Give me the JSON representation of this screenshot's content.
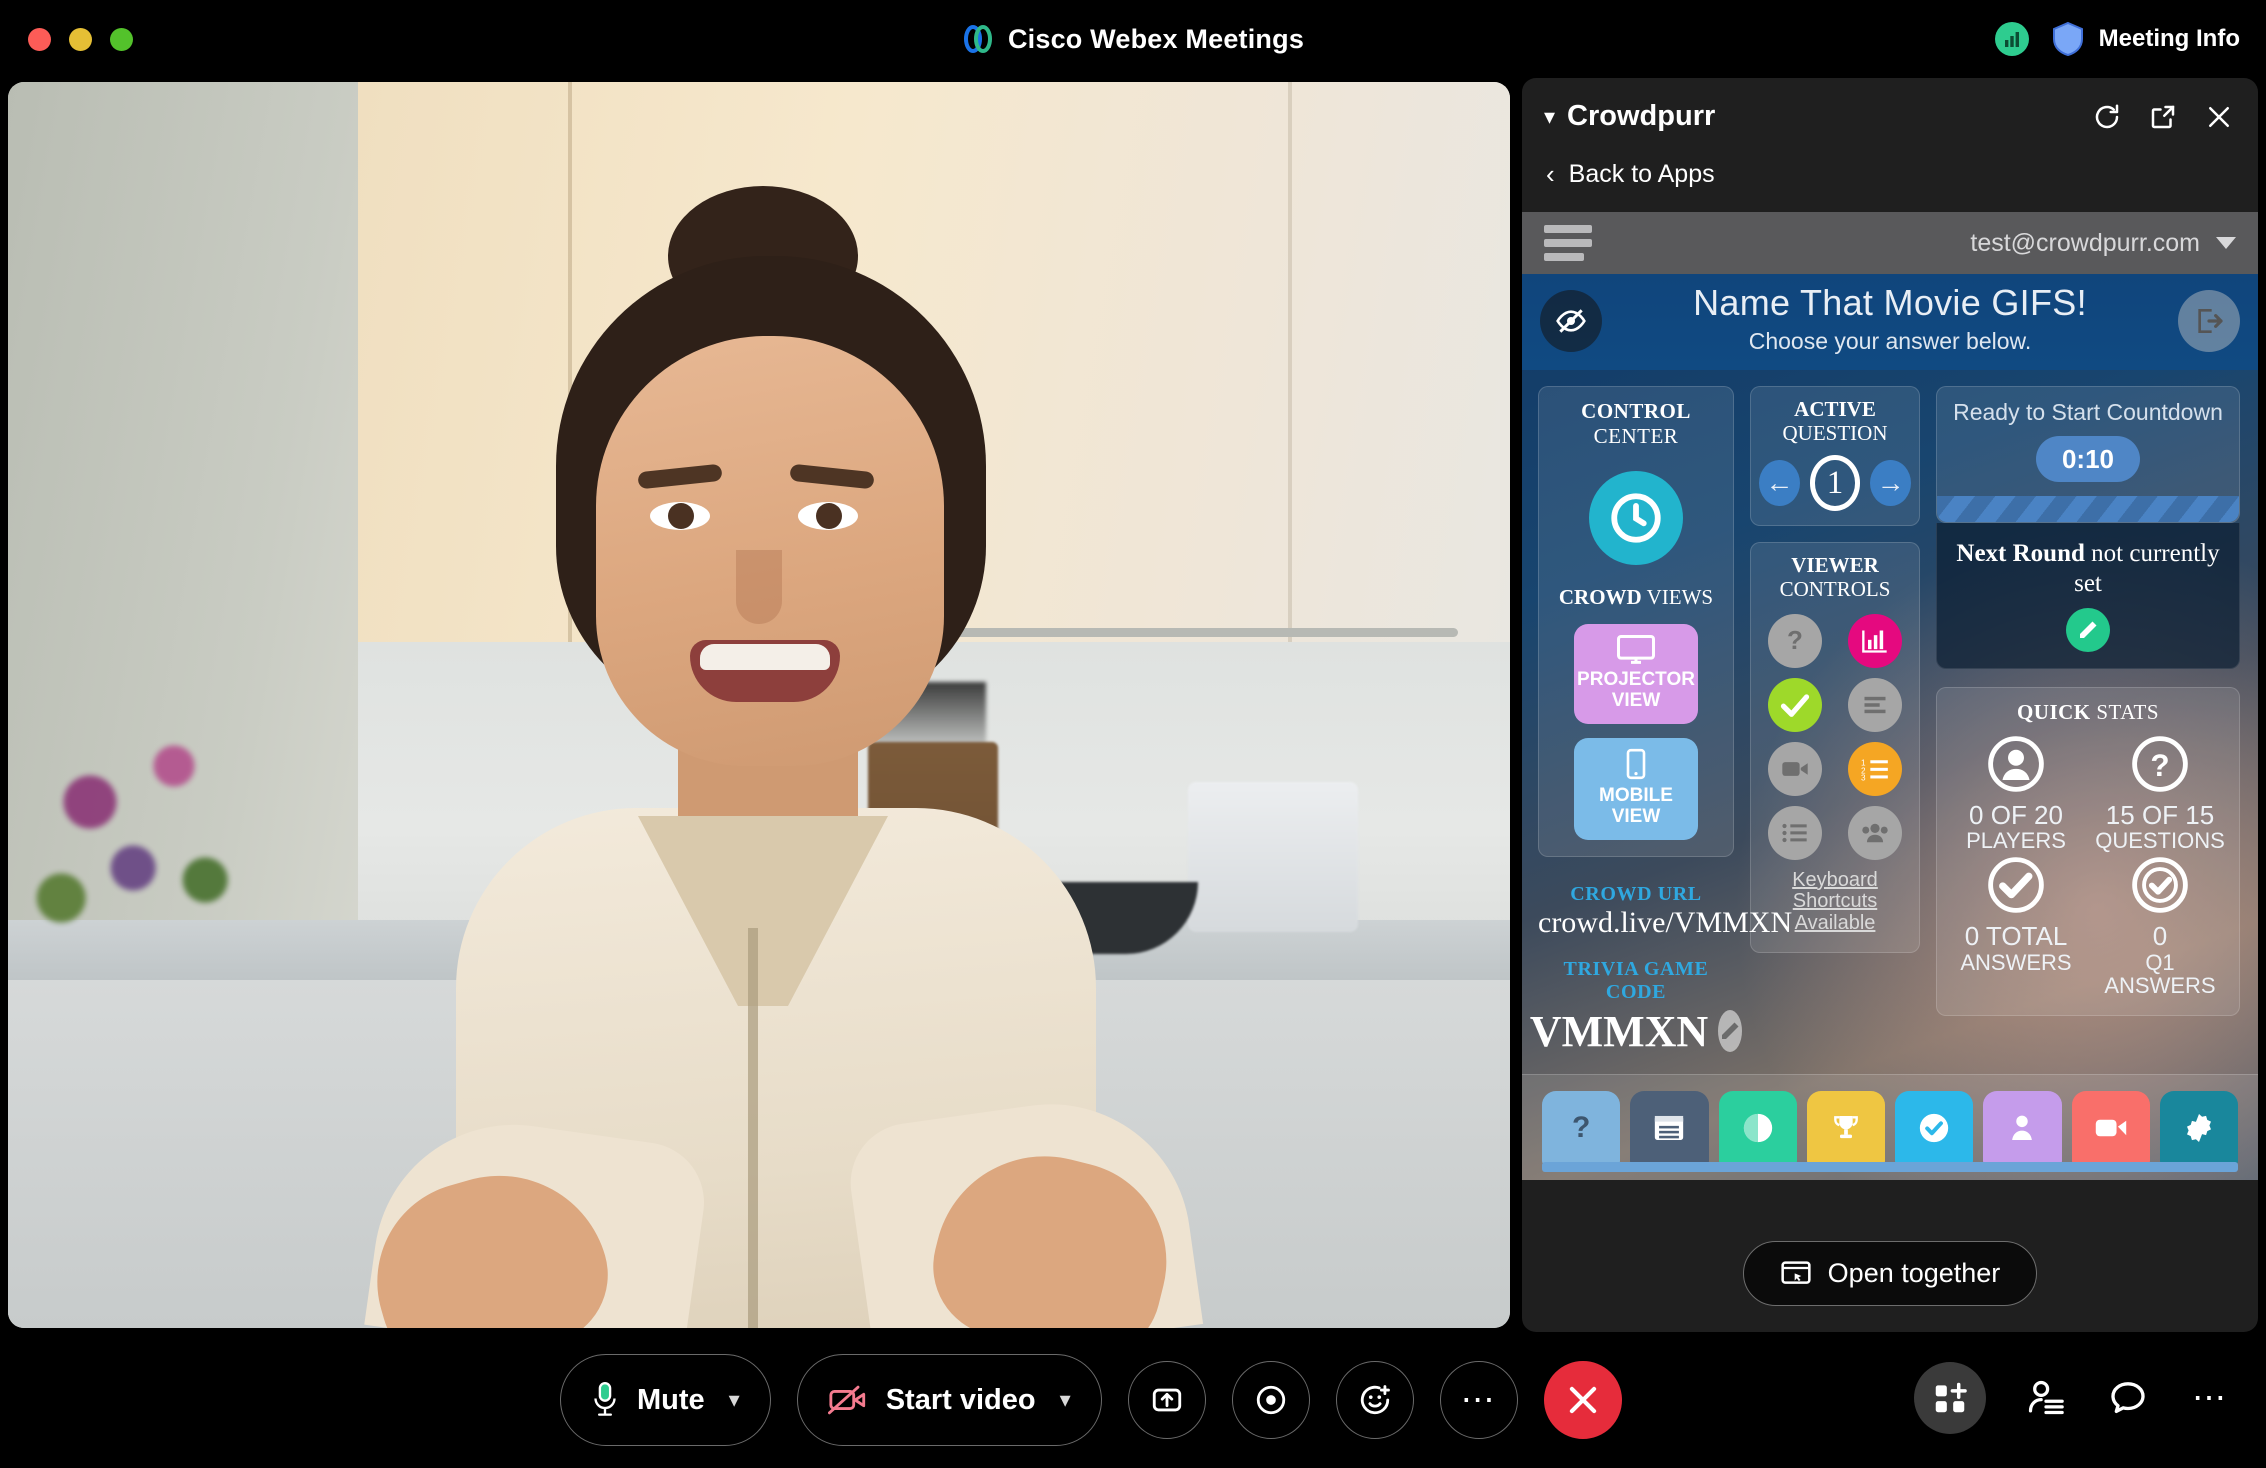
{
  "window": {
    "title": "Cisco Webex Meetings",
    "traffic_lights": [
      "close",
      "minimize",
      "maximize"
    ],
    "network_icon": "signal-bars-icon",
    "shield_icon": "shield-icon",
    "meeting_info_label": "Meeting Info"
  },
  "panel": {
    "title": "Crowdpurr",
    "collapse_icon": "chevron-down-icon",
    "refresh_icon": "refresh-icon",
    "popout_icon": "open-external-icon",
    "close_icon": "close-icon",
    "back_label": "Back to Apps",
    "back_icon": "chevron-left-icon",
    "open_together_label": "Open together",
    "open_together_icon": "screen-share-icon"
  },
  "crowdpurr": {
    "menu_icon": "hamburger-menu-icon",
    "account_email": "test@crowdpurr.com",
    "account_caret": "caret-down-icon",
    "hero": {
      "title": "Name That Movie GIFS!",
      "subtitle": "Choose your answer below.",
      "left_icon": "hide-eye-icon",
      "right_icon": "exit-arrow-icon"
    },
    "control_center": {
      "title_bold": "CONTROL",
      "title_rest": "CENTER",
      "clock_icon": "clock-icon",
      "clock_color": "#22b4cd",
      "crowd_views_bold": "CROWD",
      "crowd_views_rest": "VIEWS",
      "projector_label_line1": "PROJECTOR",
      "projector_label_line2": "VIEW",
      "projector_icon": "monitor-icon",
      "projector_color": "#d79ae8",
      "mobile_label_line1": "MOBILE",
      "mobile_label_line2": "VIEW",
      "mobile_icon": "phone-icon",
      "mobile_color": "#7bbbe8",
      "crowd_url_label": "CROWD URL",
      "crowd_url_value": "crowd.live/VMMXN",
      "game_code_label": "TRIVIA GAME CODE",
      "game_code_value": "VMMXN",
      "edit_icon": "pencil-icon"
    },
    "active_question": {
      "title_bold": "ACTIVE",
      "title_rest": "QUESTION",
      "prev_icon": "arrow-left-icon",
      "next_icon": "arrow-right-icon",
      "number": "1"
    },
    "viewer_controls": {
      "title_bold": "VIEWER",
      "title_rest": "CONTROLS",
      "buttons": [
        {
          "name": "help-icon",
          "glyph": "?",
          "color": "#a6a6a6",
          "active": false
        },
        {
          "name": "bar-chart-icon",
          "glyph": "chart",
          "color": "#e5097f",
          "active": true
        },
        {
          "name": "check-icon",
          "glyph": "check",
          "color": "#9ed92a",
          "active": true
        },
        {
          "name": "align-text-icon",
          "glyph": "lines",
          "color": "#a6a6a6",
          "active": false
        },
        {
          "name": "video-icon",
          "glyph": "video",
          "color": "#a6a6a6",
          "active": false
        },
        {
          "name": "numbered-list-icon",
          "glyph": "numlist",
          "color": "#f5a623",
          "active": true
        },
        {
          "name": "bullet-list-icon",
          "glyph": "bullets",
          "color": "#a6a6a6",
          "active": false
        },
        {
          "name": "group-users-icon",
          "glyph": "group",
          "color": "#a6a6a6",
          "active": false
        }
      ],
      "keyboard_note": "Keyboard Shortcuts Available"
    },
    "countdown": {
      "status": "Ready to Start Countdown",
      "time": "0:10",
      "next_round_bold": "Next Round",
      "next_round_rest": "not currently set",
      "edit_icon": "pencil-icon"
    },
    "quick_stats": {
      "title_bold": "QUICK",
      "title_rest": "STATS",
      "items": [
        {
          "icon": "user-icon",
          "value": "0 OF 20",
          "label": "PLAYERS"
        },
        {
          "icon": "question-icon",
          "value": "15 OF 15",
          "label": "QUESTIONS"
        },
        {
          "icon": "check-circle-icon",
          "value": "0 TOTAL",
          "label": "ANSWERS"
        },
        {
          "icon": "check-circle-small-icon",
          "value": "0",
          "label": "Q1 ANSWERS"
        }
      ]
    },
    "tabs": [
      {
        "name": "tab-help",
        "icon": "question-icon",
        "color": "#7fb4dd"
      },
      {
        "name": "tab-list",
        "icon": "list-window-icon",
        "color": "#4d6078"
      },
      {
        "name": "tab-contrast",
        "icon": "contrast-icon",
        "color": "#2bcf9e"
      },
      {
        "name": "tab-leaderboard",
        "icon": "trophy-icon",
        "color": "#efc642"
      },
      {
        "name": "tab-answers",
        "icon": "check-circle-icon",
        "color": "#2cb8ea"
      },
      {
        "name": "tab-players",
        "icon": "person-icon",
        "color": "#c59ceb"
      },
      {
        "name": "tab-media",
        "icon": "video-icon",
        "color": "#f96f6a"
      },
      {
        "name": "tab-awards",
        "icon": "badge-icon",
        "color": "#19879c"
      }
    ]
  },
  "toolbar": {
    "mute_label": "Mute",
    "mute_icon": "microphone-icon",
    "mute_caret": "chevron-down-icon",
    "video_label": "Start video",
    "video_icon": "video-off-icon",
    "video_caret": "chevron-down-icon",
    "share_icon": "share-screen-icon",
    "record_icon": "record-icon",
    "reactions_icon": "emoji-plus-icon",
    "more_icon": "more-dots-icon",
    "end_icon": "end-call-icon",
    "apps_icon": "apps-grid-plus-icon",
    "participants_icon": "participants-icon",
    "chat_icon": "chat-bubble-icon",
    "right_more_icon": "more-dots-icon"
  }
}
